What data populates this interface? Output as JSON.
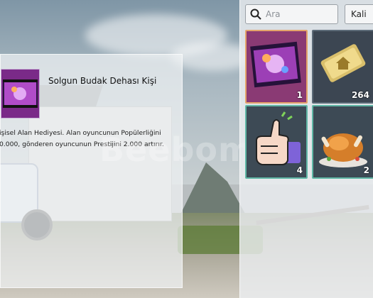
{
  "info_panel": {
    "title": "Solgun Budak Dehası Kişi",
    "description_lines": [
      "işisel Alan Hediyesi. Alan oyuncunun Popülerliğini",
      "0.000, gönderen oyuncunun Prestijini 2.000 artırır."
    ]
  },
  "watermark": "BeebomSells",
  "inventory": {
    "search": {
      "placeholder": "Ara",
      "icon": "search-icon"
    },
    "category_button": "Kali",
    "items": [
      {
        "name": "film-gift",
        "count": "1",
        "selected": true
      },
      {
        "name": "house-ticket",
        "count": "264",
        "selected": false
      },
      {
        "name": "thumbs-up",
        "count": "4",
        "selected": false
      },
      {
        "name": "roast-chicken",
        "count": "2",
        "selected": false
      }
    ]
  },
  "colors": {
    "selected_border": "#e4a46a",
    "slot_border_teal": "#5fb7a6",
    "gift_purple": "#8a3a74"
  }
}
